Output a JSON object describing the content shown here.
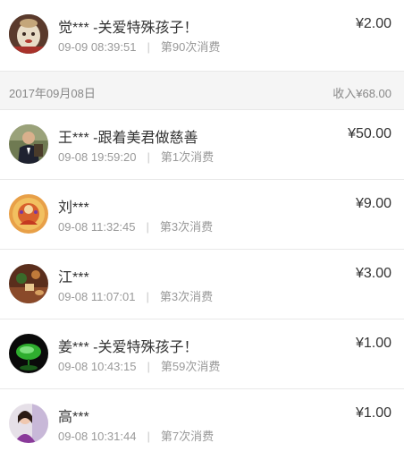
{
  "currency_symbol": "¥",
  "entries_top": [
    {
      "name": "觉*** -关爱特殊孩子！",
      "time": "09-09 08:39:51",
      "count": "第90次消费",
      "amount": "¥2.00",
      "avatar": "buddha-mask-avatar"
    }
  ],
  "group": {
    "date": "2017年09月08日",
    "income": "收入¥68.00"
  },
  "entries": [
    {
      "name": "王*** -跟着美君做慈善",
      "time": "09-08 19:59:20",
      "count": "第1次消费",
      "amount": "¥50.00",
      "avatar": "man-in-suit-avatar"
    },
    {
      "name": "刘***",
      "time": "09-08 11:32:45",
      "count": "第3次消费",
      "amount": "¥9.00",
      "avatar": "deity-painting-avatar"
    },
    {
      "name": "江***",
      "time": "09-08 11:07:01",
      "count": "第3次消费",
      "amount": "¥3.00",
      "avatar": "tea-scene-avatar"
    },
    {
      "name": "姜*** -关爱特殊孩子！",
      "time": "09-08 10:43:15",
      "count": "第59次消费",
      "amount": "¥1.00",
      "avatar": "green-leaf-avatar"
    },
    {
      "name": "高***",
      "time": "09-08 10:31:44",
      "count": "第7次消费",
      "amount": "¥1.00",
      "avatar": "woman-photo-avatar"
    }
  ],
  "colors": {
    "text": "#333333",
    "muted": "#999999",
    "divider": "#e8e8e8",
    "header_bg": "#f5f5f5"
  }
}
